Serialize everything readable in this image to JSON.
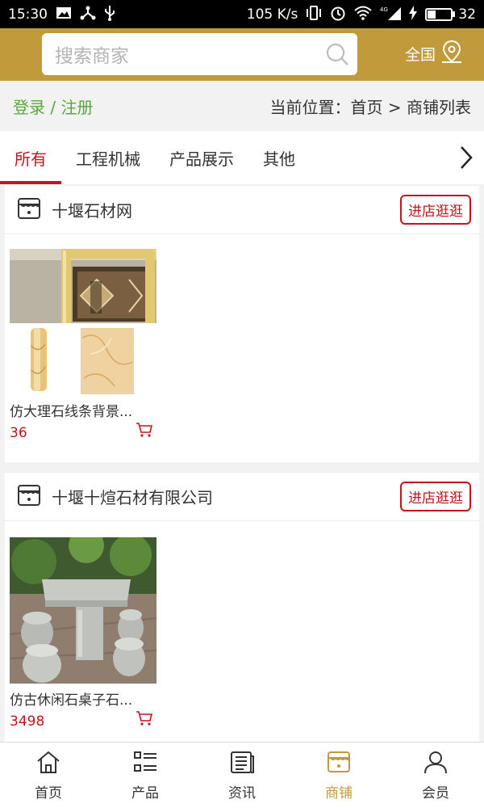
{
  "status_bar": {
    "time": "15:30",
    "net_speed": "105 K/s",
    "network": "4G",
    "battery": "32",
    "battery_level": 0.32
  },
  "header": {
    "search_placeholder": "搜索商家",
    "region_label": "全国"
  },
  "login_bar": {
    "login_label": "登录 / 注册",
    "breadcrumb": "当前位置：首页 > 商铺列表"
  },
  "tabs": [
    {
      "label": "所有",
      "active": true
    },
    {
      "label": "工程机械",
      "active": false
    },
    {
      "label": "产品展示",
      "active": false
    },
    {
      "label": "其他",
      "active": false
    }
  ],
  "shops": [
    {
      "name": "十堰石材网",
      "visit_label": "进店逛逛",
      "products": [
        {
          "title": "仿大理石线条背景...",
          "price": "36"
        }
      ]
    },
    {
      "name": "十堰十煊石材有限公司",
      "visit_label": "进店逛逛",
      "products": [
        {
          "title": "仿古休闲石桌子石...",
          "price": "3498"
        }
      ]
    }
  ],
  "bottom_nav": [
    {
      "label": "首页",
      "icon": "home-icon",
      "active": false
    },
    {
      "label": "产品",
      "icon": "list-icon",
      "active": false
    },
    {
      "label": "资讯",
      "icon": "news-icon",
      "active": false
    },
    {
      "label": "商铺",
      "icon": "store-icon",
      "active": true
    },
    {
      "label": "会员",
      "icon": "user-icon",
      "active": false
    }
  ],
  "colors": {
    "brand_gold": "#c19a3b",
    "accent_red": "#c4141c",
    "login_green": "#58a83b"
  }
}
